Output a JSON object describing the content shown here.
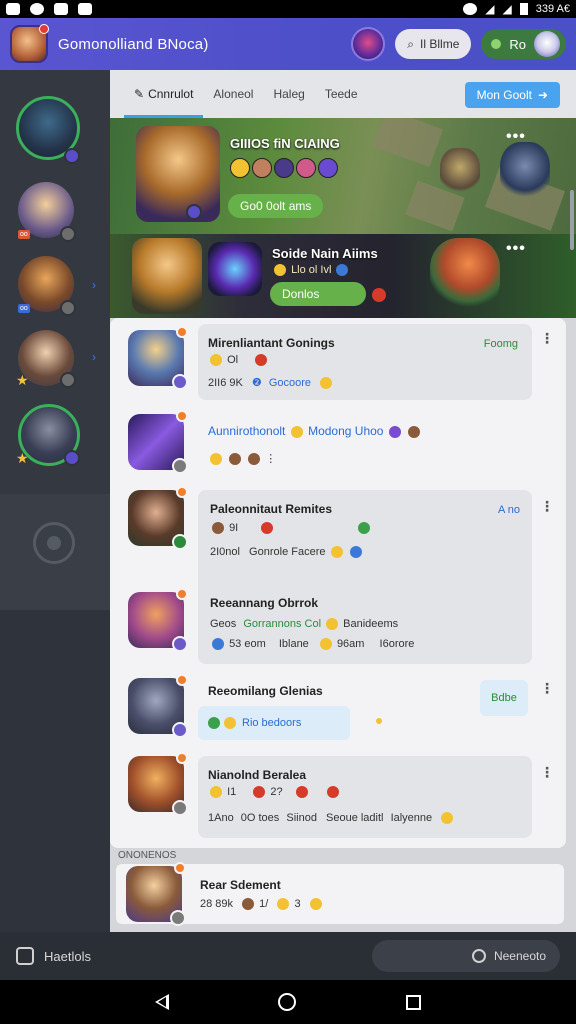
{
  "status_bar": {
    "time": "339 A€"
  },
  "app": {
    "title": "Gomonolliand BNoca)",
    "filter_pill": "Il Bllme",
    "profile_pill": "Ro"
  },
  "tabs": [
    {
      "label": "Cnnrulot"
    },
    {
      "label": "Aloneol"
    },
    {
      "label": "Haleg"
    },
    {
      "label": "Teede"
    }
  ],
  "tab_action": "Mon Goolt",
  "banner1": {
    "title": "GIIIOS fiN CIAING",
    "pill": "Go0 0olt ams"
  },
  "banner2": {
    "title": "Soide Nain Aiims",
    "subtitle": "Llo ol Ivl",
    "pill": "Donlos"
  },
  "items": [
    {
      "title": "Mirenliantant Gonings",
      "status": "Foomg",
      "line1": "Ol",
      "line2a": "2II6 9K",
      "line2b": "Gocoore"
    },
    {
      "title": "Aunnirothonolt",
      "title_b": "Modong Uhoo"
    },
    {
      "title": "Paleonnitaut Remites",
      "status": "A no",
      "line1": "9I",
      "line2a": "2I0nol",
      "line2b": "Gonrole Facere"
    },
    {
      "title": "Reeannang Obrrok",
      "line1a": "Geos",
      "line1b": "Gorrannons Col",
      "line1c": "Banideems",
      "line2a": "53 eom",
      "line2b": "Iblane",
      "line2c": "96am",
      "line2d": "I6orore"
    },
    {
      "title": "Reeomilang Glenias",
      "bubble": "Rio bedoors",
      "side_label": "Bdbe"
    },
    {
      "title": "Nianolnd Beralea",
      "line1a": "I1",
      "line1b": "2?",
      "line2a": "1Ano",
      "line2b": "0O toes",
      "line2c": "Siinod",
      "line2d": "Seoue laditl",
      "line2e": "Ialyenne"
    }
  ],
  "section2": {
    "label": "ONONENOS"
  },
  "pinned": {
    "title": "Rear Sdement",
    "meta_a": "28 89k",
    "meta_b": "1/",
    "meta_c": "3"
  },
  "bottom_bar": {
    "left_label": "Haetlols",
    "right_label": "Neeneoto"
  },
  "colors": {
    "accent": "#4c4fc8",
    "tab_indicator": "#3aa0e6",
    "success": "#67b14a",
    "status_green": "#2e8a3a"
  }
}
